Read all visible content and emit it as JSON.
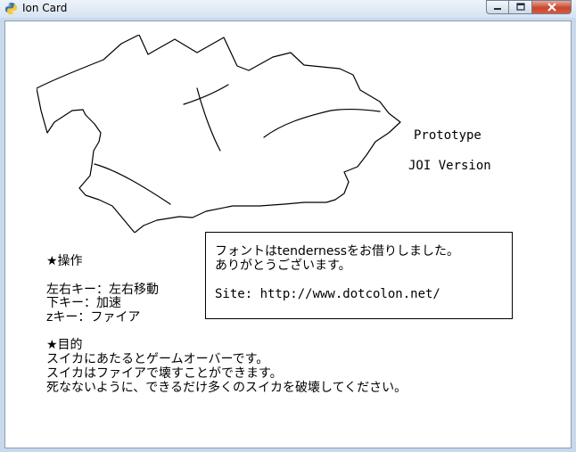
{
  "window": {
    "title": "Ion Card",
    "controls": [
      "minimize-icon",
      "maximize-icon",
      "close-icon"
    ],
    "close_color": "#c9472e"
  },
  "content": {
    "prototype_label": "Prototype",
    "version_label": "JOI Version",
    "credit": {
      "line1": "フォントはtendernessをお借りしました。",
      "line2": "ありがとうございます。",
      "site": "Site: http://www.dotcolon.net/"
    },
    "controls_section": {
      "heading": "★操作",
      "lines": [
        "左右キー：左右移動",
        "下キー：加速",
        "zキー：ファイア"
      ]
    },
    "objective_section": {
      "heading": "★目的",
      "lines": [
        "スイカにあたるとゲームオーバーです。",
        "スイカはファイアで壊すことができます。",
        "死なないように、できるだけ多くのスイカを破壊してください。"
      ]
    }
  }
}
